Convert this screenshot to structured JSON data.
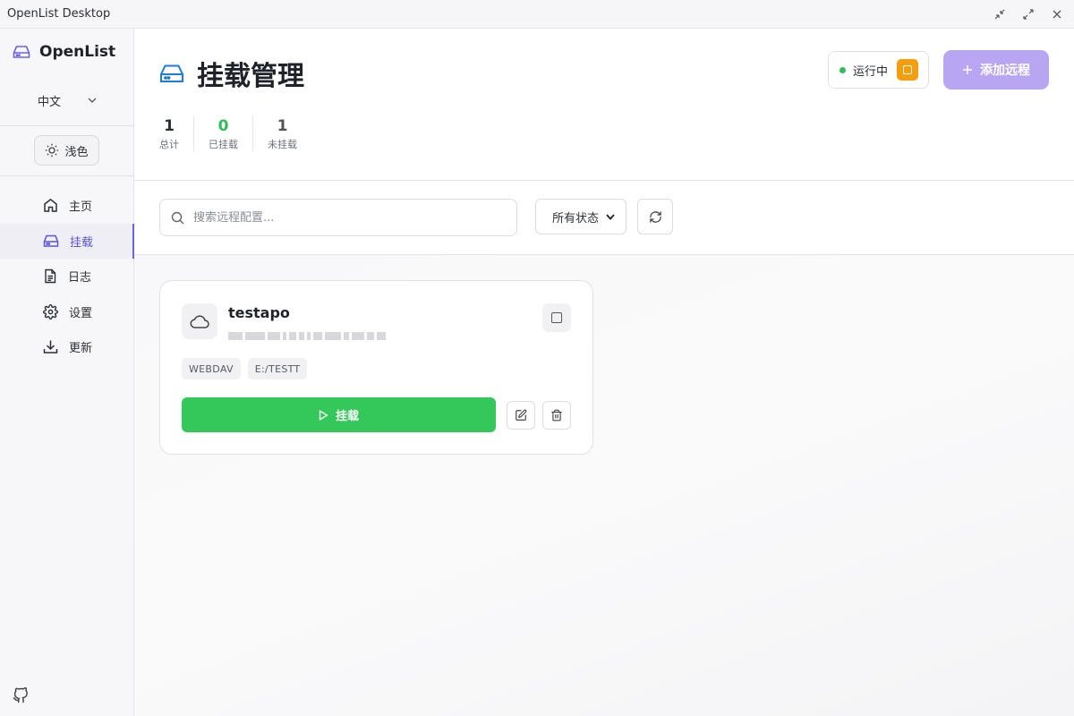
{
  "window": {
    "title": "OpenList Desktop",
    "controls": [
      "minimize-icon",
      "maximize-icon",
      "close-icon"
    ]
  },
  "sidebar": {
    "brand": "OpenList",
    "language": "中文",
    "theme_label": "浅色",
    "items": [
      {
        "label": "主页",
        "icon": "home-icon",
        "active": false
      },
      {
        "label": "挂载",
        "icon": "drive-icon",
        "active": true
      },
      {
        "label": "日志",
        "icon": "file-text-icon",
        "active": false
      },
      {
        "label": "设置",
        "icon": "gear-icon",
        "active": false
      },
      {
        "label": "更新",
        "icon": "download-icon",
        "active": false
      }
    ]
  },
  "header": {
    "title": "挂载管理",
    "stats": [
      {
        "value": "1",
        "label": "总计"
      },
      {
        "value": "0",
        "label": "已挂载"
      },
      {
        "value": "1",
        "label": "未挂载"
      }
    ],
    "status_text": "运行中",
    "add_button": "添加远程"
  },
  "toolbar": {
    "search_placeholder": "搜索远程配置...",
    "filter_value": "所有状态"
  },
  "remotes": [
    {
      "name": "testapo",
      "type": "WEBDAV",
      "mount_point": "E:/TESTT",
      "mount_label": "挂载"
    }
  ],
  "colors": {
    "accent": "#6b62e6",
    "success": "#34c759",
    "running": "#2ebd58",
    "stop": "#f59e0b",
    "add_button": "#b8a6f2"
  }
}
